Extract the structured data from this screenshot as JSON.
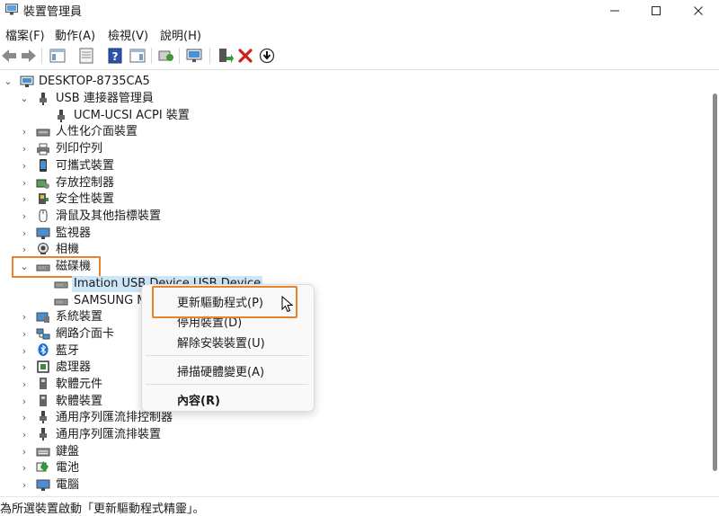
{
  "window": {
    "title": "裝置管理員",
    "minimize_icon": "minimize-icon",
    "maximize_icon": "maximize-icon",
    "close_icon": "close-icon"
  },
  "menu": [
    "檔案(F)",
    "動作(A)",
    "檢視(V)",
    "說明(H)"
  ],
  "toolbar": [
    "back-arrow-icon",
    "forward-arrow-icon",
    "show-hide-console-tree-icon",
    "properties-icon",
    "help-icon",
    "action-pane-icon",
    "scan-hardware-icon",
    "monitor-icon",
    "enable-device-icon",
    "uninstall-x-icon",
    "update-driver-icon"
  ],
  "colors": {
    "highlight": "#e8822e",
    "accent": "#0a64c8"
  },
  "tree": {
    "root": "DESKTOP-8735CA5",
    "usb_group": "USB 連接器管理員",
    "usb_child": "UCM-UCSI ACPI 裝置",
    "categories_a": [
      "人性化介面裝置",
      "列印佇列",
      "可攜式裝置",
      "存放控制器",
      "安全性裝置",
      "滑鼠及其他指標裝置",
      "監視器",
      "相機"
    ],
    "disk_group": "磁碟機",
    "disk_children": [
      "Imation USB Device USB Device",
      "SAMSUNG M"
    ],
    "categories_b": [
      "系統裝置",
      "網路介面卡",
      "藍牙",
      "處理器",
      "軟體元件",
      "軟體裝置",
      "通用序列匯流排控制器",
      "通用序列匯流排裝置",
      "鍵盤",
      "電池",
      "電腦"
    ]
  },
  "context_menu": {
    "update_driver": "更新驅動程式(P)",
    "disable_device": "停用裝置(D)",
    "uninstall_device": "解除安裝裝置(U)",
    "scan_hardware": "掃描硬體變更(A)",
    "properties": "內容(R)"
  },
  "status": "為所選裝置啟動「更新驅動程式精靈」。"
}
